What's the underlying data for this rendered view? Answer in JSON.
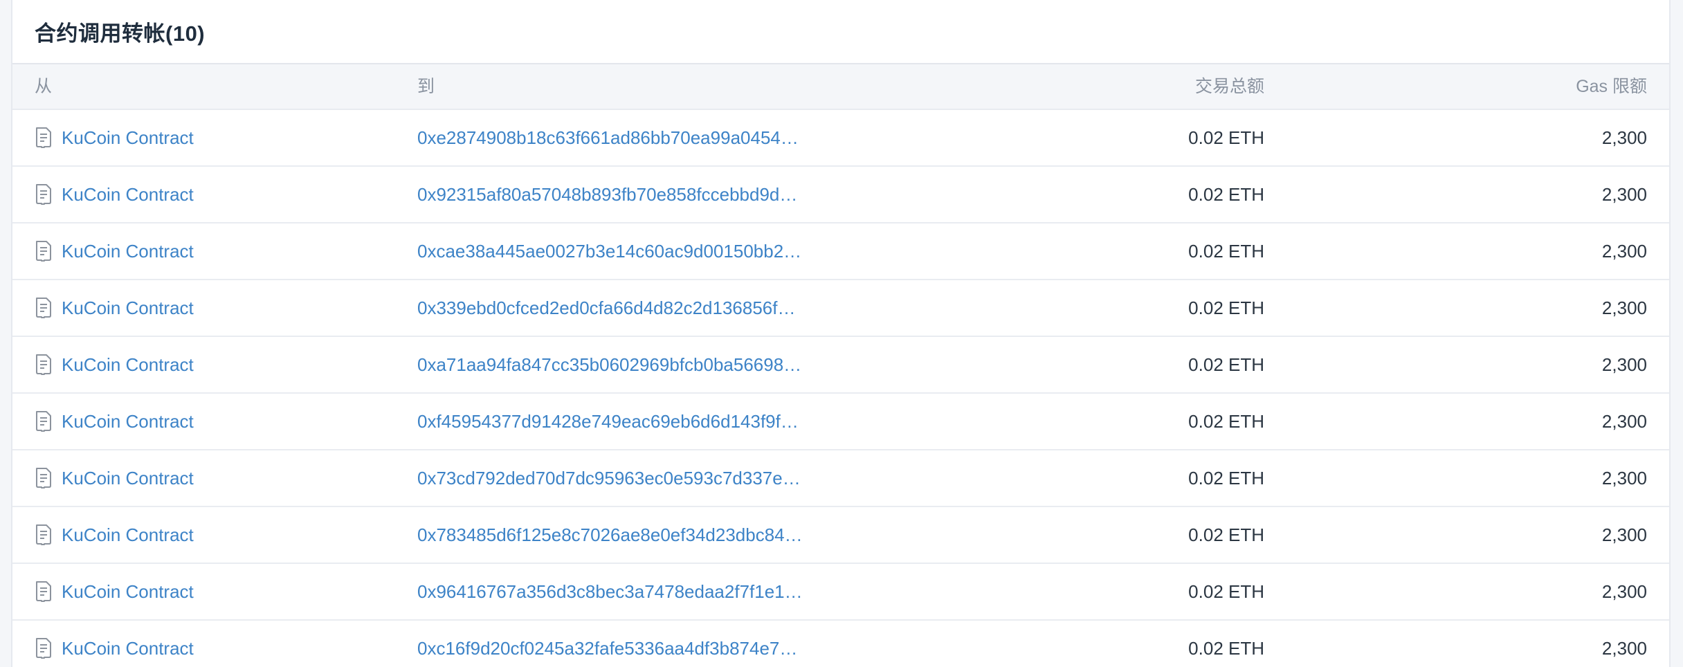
{
  "title": "合约调用转帐(10)",
  "columns": {
    "from": "从",
    "to": "到",
    "amount": "交易总额",
    "gas": "Gas 限额"
  },
  "rows": [
    {
      "from": "KuCoin Contract",
      "to": "0xe2874908b18c63f661ad86bb70ea99a0454…",
      "amount": "0.02 ETH",
      "gas": "2,300"
    },
    {
      "from": "KuCoin Contract",
      "to": "0x92315af80a57048b893fb70e858fccebbd9d…",
      "amount": "0.02 ETH",
      "gas": "2,300"
    },
    {
      "from": "KuCoin Contract",
      "to": "0xcae38a445ae0027b3e14c60ac9d00150bb2…",
      "amount": "0.02 ETH",
      "gas": "2,300"
    },
    {
      "from": "KuCoin Contract",
      "to": "0x339ebd0cfced2ed0cfa66d4d82c2d136856f…",
      "amount": "0.02 ETH",
      "gas": "2,300"
    },
    {
      "from": "KuCoin Contract",
      "to": "0xa71aa94fa847cc35b0602969bfcb0ba56698…",
      "amount": "0.02 ETH",
      "gas": "2,300"
    },
    {
      "from": "KuCoin Contract",
      "to": "0xf45954377d91428e749eac69eb6d6d143f9f…",
      "amount": "0.02 ETH",
      "gas": "2,300"
    },
    {
      "from": "KuCoin Contract",
      "to": "0x73cd792ded70d7dc95963ec0e593c7d337e…",
      "amount": "0.02 ETH",
      "gas": "2,300"
    },
    {
      "from": "KuCoin Contract",
      "to": "0x783485d6f125e8c7026ae8e0ef34d23dbc84…",
      "amount": "0.02 ETH",
      "gas": "2,300"
    },
    {
      "from": "KuCoin Contract",
      "to": "0x96416767a356d3c8bec3a7478edaa2f7f1e1…",
      "amount": "0.02 ETH",
      "gas": "2,300"
    },
    {
      "from": "KuCoin Contract",
      "to": "0xc16f9d20cf0245a32fafe5336aa4df3b874e7…",
      "amount": "0.02 ETH",
      "gas": "2,300"
    }
  ],
  "icons": {
    "from_icon": "contract-document-icon"
  },
  "colors": {
    "link": "#3d83c7",
    "header_bg": "#f4f6f9",
    "text": "#2b3642"
  }
}
